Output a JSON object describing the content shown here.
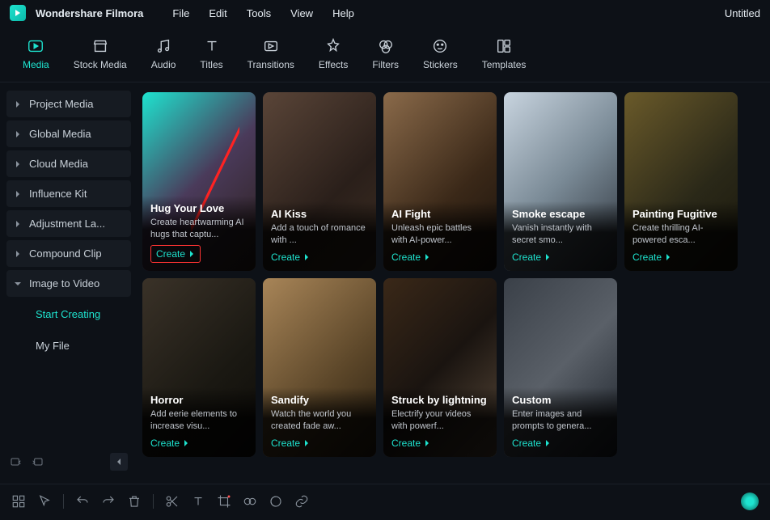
{
  "app": {
    "name": "Wondershare Filmora"
  },
  "menu": {
    "file": "File",
    "edit": "Edit",
    "tools": "Tools",
    "view": "View",
    "help": "Help"
  },
  "document": {
    "title": "Untitled"
  },
  "tabs": {
    "media": "Media",
    "stock_media": "Stock Media",
    "audio": "Audio",
    "titles": "Titles",
    "transitions": "Transitions",
    "effects": "Effects",
    "filters": "Filters",
    "stickers": "Stickers",
    "templates": "Templates"
  },
  "sidebar": {
    "items": [
      {
        "label": "Project Media"
      },
      {
        "label": "Global Media"
      },
      {
        "label": "Cloud Media"
      },
      {
        "label": "Influence Kit"
      },
      {
        "label": "Adjustment La..."
      },
      {
        "label": "Compound Clip"
      },
      {
        "label": "Image to Video"
      }
    ],
    "sub": {
      "start_creating": "Start Creating",
      "my_file": "My File"
    }
  },
  "cards": [
    {
      "title": "Hug Your Love",
      "desc": "Create heartwarming AI hugs that captu...",
      "cta": "Create"
    },
    {
      "title": "AI Kiss",
      "desc": "Add a touch of romance with ...",
      "cta": "Create"
    },
    {
      "title": "AI Fight",
      "desc": "Unleash epic battles with AI-power...",
      "cta": "Create"
    },
    {
      "title": "Smoke escape",
      "desc": "Vanish instantly with secret smo...",
      "cta": "Create"
    },
    {
      "title": "Painting Fugitive",
      "desc": "Create thrilling AI-powered esca...",
      "cta": "Create"
    },
    {
      "title": "Horror",
      "desc": "Add eerie elements to increase visu...",
      "cta": "Create"
    },
    {
      "title": "Sandify",
      "desc": "Watch the world you created fade aw...",
      "cta": "Create"
    },
    {
      "title": "Struck by lightning",
      "desc": "Electrify your videos with powerf...",
      "cta": "Create"
    },
    {
      "title": "Custom",
      "desc": "Enter images and prompts to genera...",
      "cta": "Create"
    }
  ]
}
